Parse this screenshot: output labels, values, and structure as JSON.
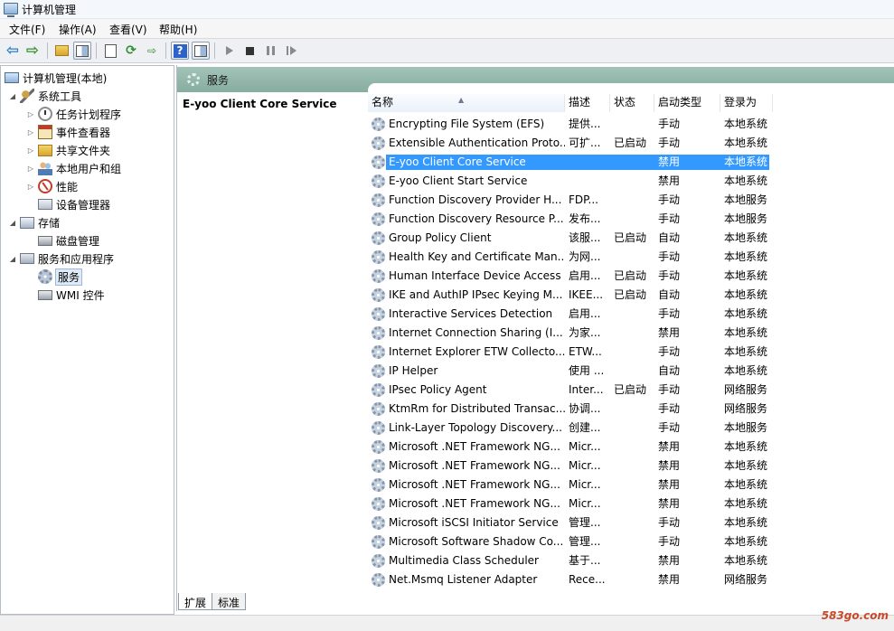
{
  "window": {
    "title": "计算机管理"
  },
  "menu": [
    "文件(F)",
    "操作(A)",
    "查看(V)",
    "帮助(H)"
  ],
  "tree": {
    "root": "计算机管理(本地)",
    "system_tools": "系统工具",
    "task_scheduler": "任务计划程序",
    "event_viewer": "事件查看器",
    "shared_folders": "共享文件夹",
    "local_users": "本地用户和组",
    "performance": "性能",
    "device_manager": "设备管理器",
    "storage": "存储",
    "disk_management": "磁盘管理",
    "services_apps": "服务和应用程序",
    "services": "服务",
    "wmi": "WMI 控件"
  },
  "content": {
    "header": "服务",
    "detail_title": "E-yoo Client Core Service",
    "columns": [
      "名称",
      "描述",
      "状态",
      "启动类型",
      "登录为"
    ],
    "selected_index": 2,
    "rows": [
      [
        "Encrypting File System (EFS)",
        "提供...",
        "",
        "手动",
        "本地系统"
      ],
      [
        "Extensible Authentication Proto...",
        "可扩...",
        "已启动",
        "手动",
        "本地系统"
      ],
      [
        "E-yoo Client Core Service",
        "",
        "",
        "禁用",
        "本地系统"
      ],
      [
        "E-yoo Client Start Service",
        "",
        "",
        "禁用",
        "本地系统"
      ],
      [
        "Function Discovery Provider H...",
        "FDP...",
        "",
        "手动",
        "本地服务"
      ],
      [
        "Function Discovery Resource P...",
        "发布...",
        "",
        "手动",
        "本地服务"
      ],
      [
        "Group Policy Client",
        "该服...",
        "已启动",
        "自动",
        "本地系统"
      ],
      [
        "Health Key and Certificate Man...",
        "为网...",
        "",
        "手动",
        "本地系统"
      ],
      [
        "Human Interface Device Access",
        "启用...",
        "已启动",
        "手动",
        "本地系统"
      ],
      [
        "IKE and AuthIP IPsec Keying M...",
        "IKEE...",
        "已启动",
        "自动",
        "本地系统"
      ],
      [
        "Interactive Services Detection",
        "启用...",
        "",
        "手动",
        "本地系统"
      ],
      [
        "Internet Connection Sharing (I...",
        "为家...",
        "",
        "禁用",
        "本地系统"
      ],
      [
        "Internet Explorer ETW Collecto...",
        "ETW...",
        "",
        "手动",
        "本地系统"
      ],
      [
        "IP Helper",
        "使用 ...",
        "",
        "自动",
        "本地系统"
      ],
      [
        "IPsec Policy Agent",
        "Inter...",
        "已启动",
        "手动",
        "网络服务"
      ],
      [
        "KtmRm for Distributed Transac...",
        "协调...",
        "",
        "手动",
        "网络服务"
      ],
      [
        "Link-Layer Topology Discovery...",
        "创建...",
        "",
        "手动",
        "本地服务"
      ],
      [
        "Microsoft .NET Framework NG...",
        "Micr...",
        "",
        "禁用",
        "本地系统"
      ],
      [
        "Microsoft .NET Framework NG...",
        "Micr...",
        "",
        "禁用",
        "本地系统"
      ],
      [
        "Microsoft .NET Framework NG...",
        "Micr...",
        "",
        "禁用",
        "本地系统"
      ],
      [
        "Microsoft .NET Framework NG...",
        "Micr...",
        "",
        "禁用",
        "本地系统"
      ],
      [
        "Microsoft iSCSI Initiator Service",
        "管理...",
        "",
        "手动",
        "本地系统"
      ],
      [
        "Microsoft Software Shadow Co...",
        "管理...",
        "",
        "手动",
        "本地系统"
      ],
      [
        "Multimedia Class Scheduler",
        "基于...",
        "",
        "禁用",
        "本地系统"
      ],
      [
        "Net.Msmq Listener Adapter",
        "Rece...",
        "",
        "禁用",
        "网络服务"
      ]
    ]
  },
  "tabs": [
    "扩展",
    "标准"
  ],
  "watermark": "583go.com"
}
